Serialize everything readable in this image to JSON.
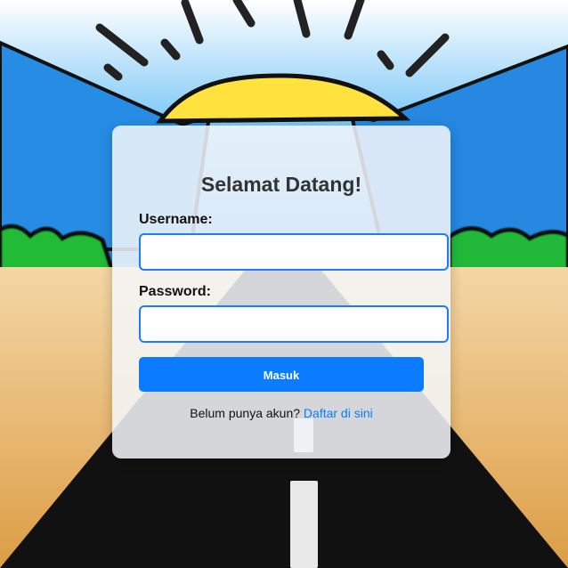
{
  "app": {
    "title": "Selamat Datang!"
  },
  "login_form": {
    "username_label": "Username:",
    "username_value": "",
    "username_placeholder": "",
    "password_label": "Password:",
    "password_value": "",
    "password_placeholder": "",
    "submit_label": "Masuk",
    "register_prompt": "Belum punya akun?",
    "register_link": "Daftar di sini"
  },
  "colors": {
    "accent": "#0b7cff",
    "input_border": "#1b7cff",
    "card_background": "#f5f7fa",
    "sky": "#2f8fe1",
    "grass": "#21b83c",
    "road": "#111111",
    "sand": "#e6b66f"
  }
}
